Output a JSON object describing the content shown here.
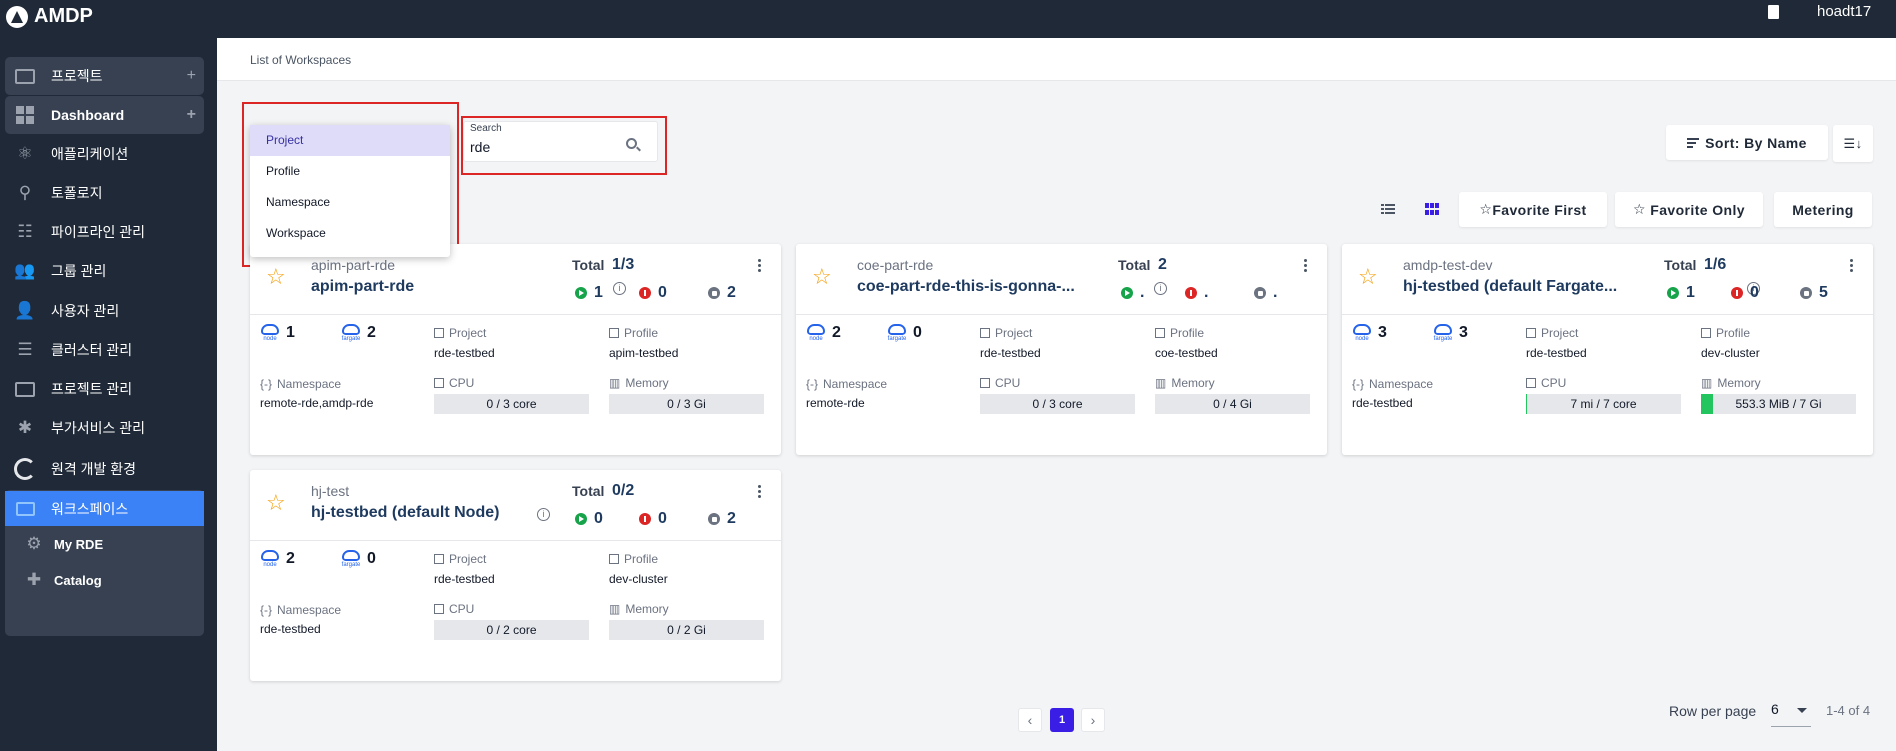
{
  "app": {
    "brand": "AMDP",
    "user": "hoadt17"
  },
  "breadcrumb": "List of Workspaces",
  "sidebar": {
    "items": [
      {
        "label": "프로젝트"
      },
      {
        "label": "Dashboard"
      },
      {
        "label": "애플리케이션"
      },
      {
        "label": "토폴로지"
      },
      {
        "label": "파이프라인 관리"
      },
      {
        "label": "그룹 관리"
      },
      {
        "label": "사용자 관리"
      },
      {
        "label": "클러스터 관리"
      },
      {
        "label": "프로젝트 관리"
      },
      {
        "label": "부가서비스 관리"
      },
      {
        "label": "원격 개발 환경"
      },
      {
        "label": "워크스페이스"
      },
      {
        "label": "My RDE"
      },
      {
        "label": "Catalog"
      }
    ],
    "plus": "+"
  },
  "filter": {
    "options": [
      "Project",
      "Profile",
      "Namespace",
      "Workspace"
    ],
    "selected": "Project"
  },
  "search": {
    "label": "Search",
    "value": "rde"
  },
  "toolbar": {
    "sort_label": "Sort: By Name",
    "favorite_first": "Favorite First",
    "favorite_only": "Favorite Only",
    "metering": "Metering"
  },
  "labels": {
    "total": "Total",
    "project": "Project",
    "profile": "Profile",
    "namespace": "Namespace",
    "cpu": "CPU",
    "memory": "Memory",
    "node": "node",
    "fargate": "fargate"
  },
  "cards": [
    {
      "project": "apim-part-rde",
      "name": "apim-part-rde",
      "total": "1/3",
      "running": "1",
      "error": "0",
      "stopped": "2",
      "node": "1",
      "fargate": "2",
      "f_project": "rde-testbed",
      "f_profile": "apim-testbed",
      "namespace": "remote-rde,amdp-rde",
      "cpu": "0 / 3 core",
      "cpu_fraction": 0,
      "memory": "0 / 3 Gi",
      "memory_fraction": 0
    },
    {
      "project": "coe-part-rde",
      "name": "coe-part-rde-this-is-gonna-...",
      "total": "2",
      "running": ".",
      "error": ".",
      "stopped": ".",
      "node": "2",
      "fargate": "0",
      "f_project": "rde-testbed",
      "f_profile": "coe-testbed",
      "namespace": "remote-rde",
      "cpu": "0 / 3 core",
      "cpu_fraction": 0,
      "memory": "0 / 4 Gi",
      "memory_fraction": 0
    },
    {
      "project": "amdp-test-dev",
      "name": "hj-testbed (default Fargate...",
      "total": "1/6",
      "running": "1",
      "error": "0",
      "stopped": "5",
      "node": "3",
      "fargate": "3",
      "f_project": "rde-testbed",
      "f_profile": "dev-cluster",
      "namespace": "rde-testbed",
      "cpu": "7 mi / 7 core",
      "cpu_fraction": 0.001,
      "memory": "553.3 MiB / 7 Gi",
      "memory_fraction": 0.077
    },
    {
      "project": "hj-test",
      "name": "hj-testbed (default Node)",
      "total": "0/2",
      "running": "0",
      "error": "0",
      "stopped": "2",
      "node": "2",
      "fargate": "0",
      "f_project": "rde-testbed",
      "f_profile": "dev-cluster",
      "namespace": "rde-testbed",
      "cpu": "0 / 2 core",
      "cpu_fraction": 0,
      "memory": "0 / 2 Gi",
      "memory_fraction": 0
    }
  ],
  "pagination": {
    "current": "1",
    "rows_label": "Row per page",
    "rows_value": "6",
    "range": "1-4 of 4"
  },
  "colors": {
    "accent": "#3b82f6",
    "page_active": "#3b1ee6",
    "highlight_box": "#dc2626"
  }
}
